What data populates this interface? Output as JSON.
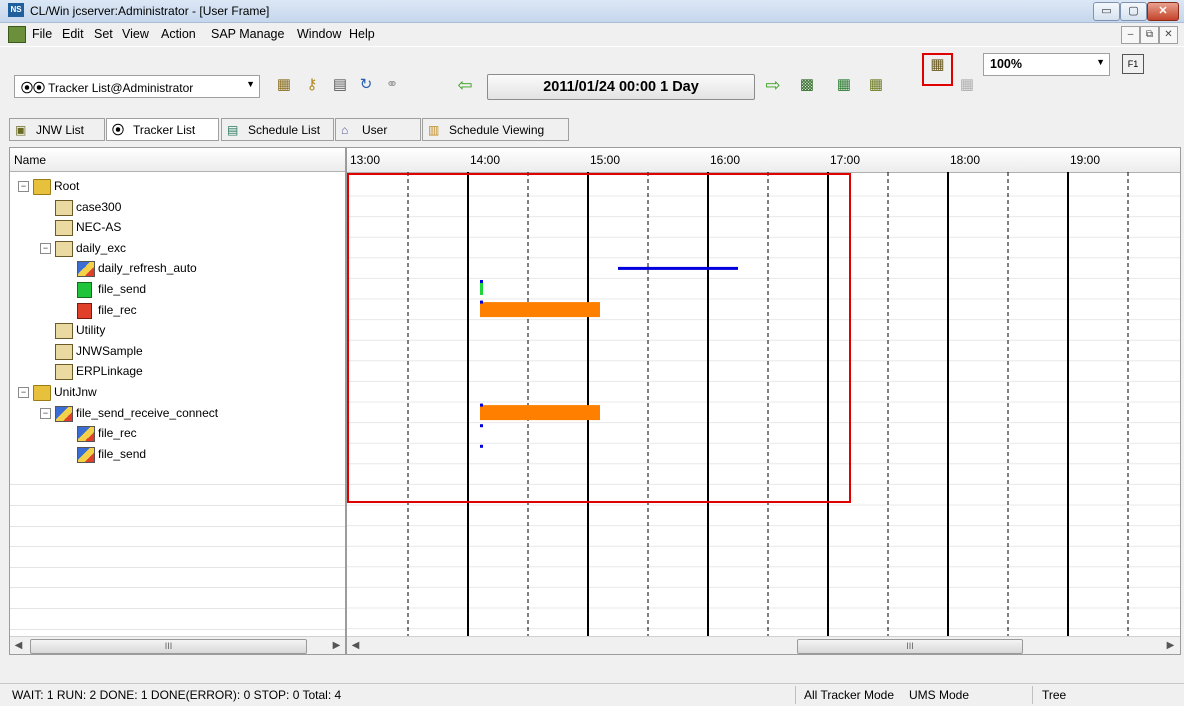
{
  "window": {
    "app_icon": "NS",
    "title": "CL/Win jcserver:Administrator - [User Frame]",
    "controls": {
      "minimize": "▭",
      "maximize": "▢",
      "close": "✕"
    }
  },
  "menubar": {
    "items": [
      "File",
      "Edit",
      "Set",
      "View",
      "Action",
      "SAP Manage",
      "Window",
      "Help"
    ],
    "mdi_controls": {
      "minimize": "–",
      "restore": "⧉",
      "close": "✕"
    }
  },
  "toolbar": {
    "tracker_combo": {
      "icon": "⦿⦿",
      "value": "Tracker List@Administrator"
    },
    "date_display": "2011/01/24 00:00   1 Day",
    "zoom_combo": {
      "value": "100%"
    },
    "help_icon": "F1",
    "icons": [
      "open-icon",
      "key-icon",
      "properties-icon",
      "refresh-icon",
      "binoculars-icon",
      "back-arrow-icon",
      "forward-arrow-icon",
      "filter-icon",
      "calendar-icon",
      "calendar-icon",
      "highlighted-view-icon",
      "disabled-view-icon"
    ]
  },
  "tabs": [
    {
      "label": "JNW List",
      "icon": "jnw-icon"
    },
    {
      "label": "Tracker List",
      "icon": "tracker-icon",
      "selected": true,
      "highlighted": true
    },
    {
      "label": "Schedule List",
      "icon": "schedule-icon"
    },
    {
      "label": "User Menu",
      "icon": "user-menu-icon"
    },
    {
      "label": "Schedule Viewing",
      "icon": "schedule-viewing-icon"
    }
  ],
  "tree": {
    "header": "Name",
    "nodes": [
      {
        "label": "Root",
        "level": 0,
        "type": "folder",
        "expander": "−"
      },
      {
        "label": "case300",
        "level": 1,
        "type": "jobnet"
      },
      {
        "label": "NEC-AS",
        "level": 1,
        "type": "jobnet"
      },
      {
        "label": "daily_exc",
        "level": 1,
        "type": "jobnet-group",
        "expander": "−"
      },
      {
        "label": "daily_refresh_auto",
        "level": 2,
        "type": "job-multi"
      },
      {
        "label": "file_send",
        "level": 2,
        "type": "job-green"
      },
      {
        "label": "file_rec",
        "level": 2,
        "type": "job-red"
      },
      {
        "label": "Utility",
        "level": 1,
        "type": "jobnet"
      },
      {
        "label": "JNWSample",
        "level": 1,
        "type": "jobnet"
      },
      {
        "label": "ERPLinkage",
        "level": 1,
        "type": "jobnet"
      },
      {
        "label": "UnitJnw",
        "level": 0,
        "type": "folder",
        "expander": "−"
      },
      {
        "label": "file_send_receive_connect",
        "level": 1,
        "type": "job-multi",
        "expander": "−"
      },
      {
        "label": "file_rec",
        "level": 2,
        "type": "job-multi"
      },
      {
        "label": "file_send",
        "level": 2,
        "type": "job-multi"
      }
    ],
    "hscroll_thumb": "III"
  },
  "chart": {
    "hours": [
      "13:00",
      "14:00",
      "15:00",
      "16:00",
      "17:00",
      "18:00",
      "19:00"
    ],
    "hscroll_thumb": "III",
    "colors": {
      "blue_bar": "#0000dd",
      "orange_bar": "#ff8000",
      "green_bar": "#1fd43b",
      "highlight_box": "#e00000"
    }
  },
  "chart_data": {
    "type": "gantt",
    "x_unit": "time of day",
    "bars": [
      {
        "row": 4,
        "start": "15:15",
        "end": "16:15",
        "color": "blue"
      },
      {
        "row": 5,
        "start": "14:06",
        "end": "14:07",
        "color": "green"
      },
      {
        "row": 6,
        "start": "14:06",
        "end": "15:06",
        "color": "orange"
      },
      {
        "row": 11,
        "start": "14:06",
        "end": "15:06",
        "color": "orange"
      }
    ],
    "markers": [
      {
        "row": 5,
        "time": "14:06",
        "color": "blue"
      },
      {
        "row": 6,
        "time": "14:06",
        "color": "blue"
      },
      {
        "row": 11,
        "time": "14:06",
        "color": "blue"
      },
      {
        "row": 12,
        "time": "14:06",
        "color": "blue"
      },
      {
        "row": 13,
        "time": "14:06",
        "color": "blue"
      }
    ]
  },
  "statusbar": {
    "counts": "WAIT: 1   RUN: 2   DONE: 1   DONE(ERROR): 0   STOP: 0   Total: 4",
    "mode1": "All Tracker Mode",
    "mode2": "UMS Mode",
    "view": "Tree"
  }
}
